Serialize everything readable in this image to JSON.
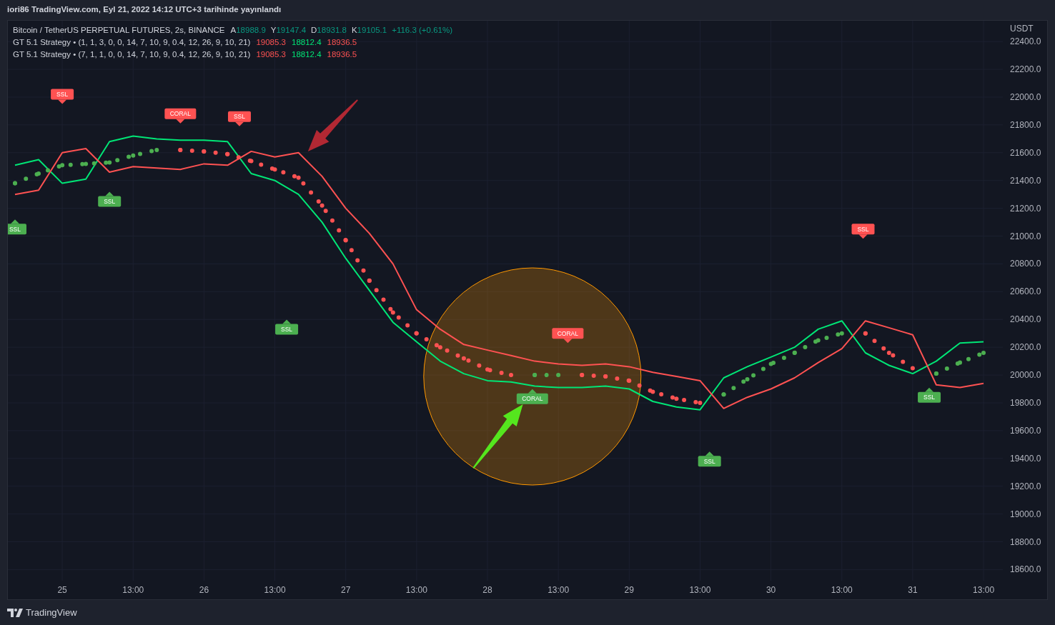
{
  "header": {
    "title": "iori86 TradingView.com, Eyl 21, 2022 14:12 UTC+3 tarihinde yayınlandı"
  },
  "chart": {
    "legend": {
      "symbol": "Bitcoin / TetherUS PERPETUAL FUTURES, 2s, BINANCE",
      "ohlc": [
        {
          "label": "A",
          "value": "18988.9"
        },
        {
          "label": "Y",
          "value": "19147.4"
        },
        {
          "label": "D",
          "value": "18931.8"
        },
        {
          "label": "K",
          "value": "19105.1"
        }
      ],
      "change": "+116.3 (+0.61%)"
    },
    "indicators": [
      {
        "name": "GT 5.1 Strategy • (1, 1, 3, 0, 0, 14, 7, 10, 9, 0.4, 12, 26, 9, 10, 21)",
        "values": [
          {
            "text": "19085.3",
            "color": "#ff5252"
          },
          {
            "text": "18812.4",
            "color": "#00e676"
          },
          {
            "text": "18936.5",
            "color": "#ff5252"
          }
        ]
      },
      {
        "name": "GT 5.1 Strategy • (7, 1, 1, 0, 0, 14, 7, 10, 9, 0.4, 12, 26, 9, 10, 21)",
        "values": [
          {
            "text": "19085.3",
            "color": "#ff5252"
          },
          {
            "text": "18812.4",
            "color": "#00e676"
          },
          {
            "text": "18936.5",
            "color": "#ff5252"
          }
        ]
      }
    ],
    "price_axis": {
      "currency": "USDT"
    },
    "chart_data": {
      "type": "line",
      "grid": true,
      "categories": [
        null,
        null,
        "25",
        null,
        null,
        "13:00",
        null,
        null,
        "26",
        null,
        null,
        "13:00",
        null,
        null,
        "27",
        null,
        null,
        "13:00",
        null,
        null,
        "28",
        null,
        null,
        "13:00",
        null,
        null,
        "29",
        null,
        null,
        "13:00",
        null,
        null,
        "30",
        null,
        null,
        "13:00",
        null,
        null,
        "31",
        null,
        null,
        "13:00"
      ],
      "series": [
        {
          "color": "#00e676",
          "values": [
            21510,
            21550,
            21380,
            21410,
            21680,
            21720,
            21700,
            21690,
            21690,
            21680,
            21450,
            21400,
            21300,
            21100,
            20840,
            20610,
            20380,
            20240,
            20100,
            20010,
            19960,
            19950,
            19920,
            19910,
            19910,
            19920,
            19900,
            19810,
            19770,
            19750,
            19980,
            20060,
            20130,
            20200,
            20330,
            20390,
            20160,
            20070,
            20010,
            20100,
            20230,
            20240
          ]
        },
        {
          "color": "#ff5252",
          "values": [
            21300,
            21330,
            21600,
            21630,
            21460,
            21500,
            21490,
            21480,
            21520,
            21510,
            21610,
            21570,
            21600,
            21430,
            21200,
            21020,
            20800,
            20470,
            20330,
            20220,
            20180,
            20140,
            20100,
            20080,
            20070,
            20080,
            20060,
            20020,
            19990,
            19960,
            19760,
            19840,
            19900,
            19980,
            20090,
            20190,
            20390,
            20340,
            20290,
            19930,
            19910,
            19940
          ]
        },
        {
          "color": "#4caf50",
          "line_style": "dotted",
          "values": [
            21380,
            21450,
            21510,
            21520,
            21530,
            21580,
            21620,
            null,
            null,
            null,
            null,
            null,
            null,
            null,
            null,
            null,
            null,
            null,
            null,
            null,
            null,
            null,
            20000,
            20000,
            null,
            null,
            null,
            null,
            null,
            null,
            19860,
            19970,
            20080,
            20160,
            20250,
            20300,
            null,
            null,
            null,
            20010,
            20090,
            20160
          ]
        },
        {
          "color": "#ff5252",
          "line_style": "dotted",
          "values": [
            null,
            null,
            null,
            null,
            null,
            null,
            null,
            21620,
            21610,
            21590,
            21540,
            21480,
            21420,
            21220,
            20970,
            20680,
            20450,
            20300,
            20200,
            20120,
            20040,
            20000,
            null,
            null,
            20000,
            19990,
            19960,
            19880,
            19830,
            19800,
            null,
            null,
            null,
            null,
            null,
            null,
            20300,
            20160,
            20050,
            null,
            null,
            null
          ]
        }
      ],
      "ylim": [
        18520,
        22550
      ],
      "yticks": [
        {
          "value": 18600,
          "label": "18600.0"
        },
        {
          "value": 18800,
          "label": "18800.0"
        },
        {
          "value": 19000,
          "label": "19000.0"
        },
        {
          "value": 19200,
          "label": "19200.0"
        },
        {
          "value": 19400,
          "label": "19400.0"
        },
        {
          "value": 19600,
          "label": "19600.0"
        },
        {
          "value": 19800,
          "label": "19800.0"
        },
        {
          "value": 20000,
          "label": "20000.0"
        },
        {
          "value": 20200,
          "label": "20200.0"
        },
        {
          "value": 20400,
          "label": "20400.0"
        },
        {
          "value": 20600,
          "label": "20600.0"
        },
        {
          "value": 20800,
          "label": "20800.0"
        },
        {
          "value": 21000,
          "label": "21000.0"
        },
        {
          "value": 21200,
          "label": "21200.0"
        },
        {
          "value": 21400,
          "label": "21400.0"
        },
        {
          "value": 21600,
          "label": "21600.0"
        },
        {
          "value": 21800,
          "label": "21800.0"
        },
        {
          "value": 22000,
          "label": "22000.0"
        },
        {
          "value": 22200,
          "label": "22200.0"
        },
        {
          "value": 22400,
          "label": "22400.0"
        }
      ],
      "annotations": [
        "SSL",
        "CORAL",
        "SSL",
        "SSL",
        "SSL",
        "SSL",
        "SSL",
        "CORAL",
        "CORAL",
        "SSL",
        "SSL"
      ]
    }
  },
  "footer": {
    "brand": "TradingView"
  }
}
